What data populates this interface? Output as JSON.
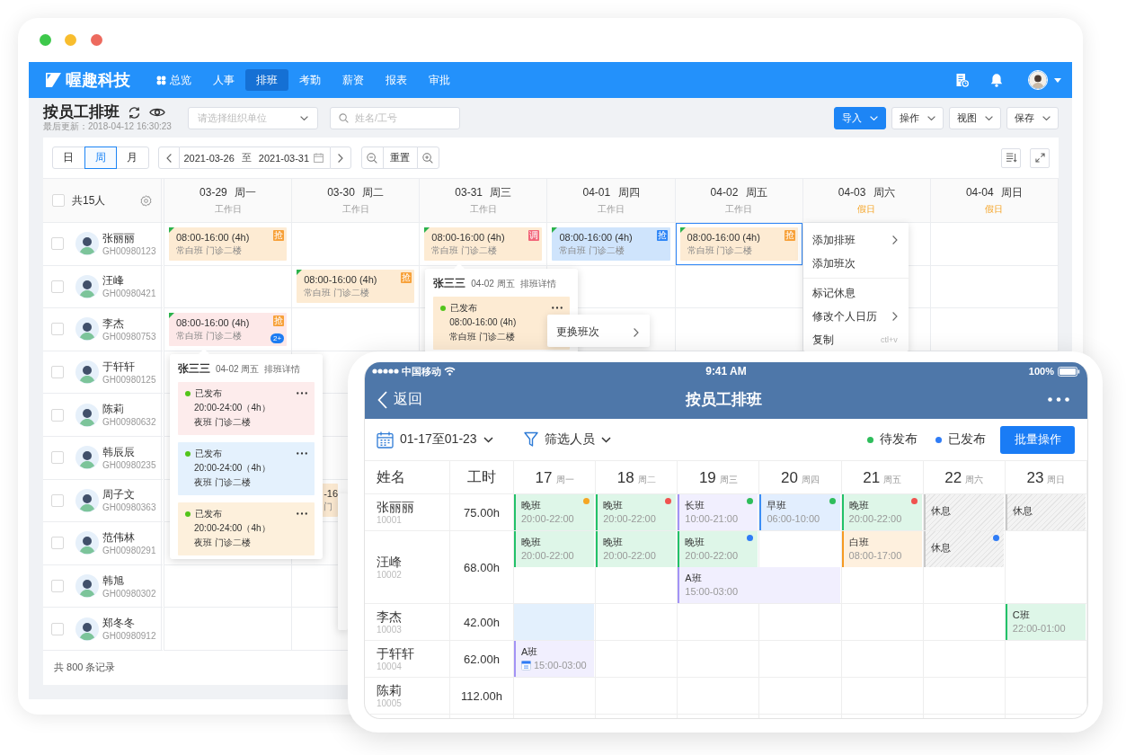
{
  "window": {
    "controls": [
      {
        "color": "#3dc84b"
      },
      {
        "color": "#f8bd2e"
      },
      {
        "color": "#ed6a5e"
      }
    ]
  },
  "desktop": {
    "app_bar": {
      "logo": "喔趣科技",
      "nav": [
        {
          "label": "总览",
          "icon": true,
          "selected": false
        },
        {
          "label": "人事",
          "selected": false
        },
        {
          "label": "排班",
          "selected": true
        },
        {
          "label": "考勤",
          "selected": false
        },
        {
          "label": "薪资",
          "selected": false
        },
        {
          "label": "报表",
          "selected": false
        },
        {
          "label": "审批",
          "selected": false
        }
      ]
    },
    "page_header": {
      "title": "按员工排班",
      "updated": "最后更新：2018-04-12 16:30:23",
      "org_select": {
        "placeholder": "请选择组织单位"
      },
      "search": {
        "placeholder": "姓名/工号"
      },
      "actions": [
        {
          "label": "导入",
          "kind": "primary"
        },
        {
          "label": "操作",
          "kind": "default"
        },
        {
          "label": "视图",
          "kind": "default"
        },
        {
          "label": "保存",
          "kind": "default"
        }
      ]
    },
    "toolbar": {
      "views": [
        {
          "label": "日",
          "selected": false
        },
        {
          "label": "周",
          "selected": true
        },
        {
          "label": "月",
          "selected": false
        }
      ],
      "range": {
        "start": "2021-03-26",
        "separator": "至",
        "end": "2021-03-31"
      },
      "reset": "重置"
    },
    "table": {
      "header": {
        "count": "共15人",
        "checked": false
      },
      "days": [
        {
          "date": "03-29",
          "weekday": "周一",
          "type": "工作日",
          "holiday": false
        },
        {
          "date": "03-30",
          "weekday": "周二",
          "type": "工作日",
          "holiday": false
        },
        {
          "date": "03-31",
          "weekday": "周三",
          "type": "工作日",
          "holiday": false
        },
        {
          "date": "04-01",
          "weekday": "周四",
          "type": "工作日",
          "holiday": false
        },
        {
          "date": "04-02",
          "weekday": "周五",
          "type": "工作日",
          "holiday": false
        },
        {
          "date": "04-03",
          "weekday": "周六",
          "type": "假日",
          "holiday": true
        },
        {
          "date": "04-04",
          "weekday": "周日",
          "type": "假日",
          "holiday": true
        }
      ],
      "rows": [
        {
          "name": "张丽丽",
          "id": "GH00980123",
          "checked": false,
          "cells": [
            {
              "selected": false,
              "shift": {
                "time": "08:00-16:00 (4h)",
                "place": "常白班 门诊二楼",
                "color": "#fdebd3",
                "flag": true,
                "badge": {
                  "text": "抢",
                  "color": "#f7a13a"
                }
              }
            },
            {
              "selected": false
            },
            {
              "selected": false,
              "shift": {
                "time": "08:00-16:00 (4h)",
                "place": "常白班 门诊二楼",
                "color": "#fdebd3",
                "flag": true,
                "badge": {
                  "text": "调",
                  "color": "#f26579"
                }
              },
              "popover": {
                "name": "张三三",
                "date": "04-02 周五",
                "title": "排班详情",
                "entries": [
                  {
                    "status": "已发布",
                    "dot": {
                      "color": "#52c41a"
                    },
                    "time": "08:00-16:00 (4h)",
                    "place": "常白班 门诊二楼",
                    "color": "#fdebd3",
                    "menu": {
                      "items": [
                        {
                          "label": "更换班次",
                          "kind": "submenu"
                        }
                      ]
                    }
                  }
                ]
              }
            },
            {
              "selected": false,
              "shift": {
                "time": "08:00-16:00 (4h)",
                "place": "常白班 门诊二楼",
                "color": "#cfe4fc",
                "flag": true,
                "badge": {
                  "text": "抢",
                  "color": "#2f86f6"
                }
              }
            },
            {
              "selected": true,
              "shift": {
                "time": "08:00-16:00 (4h)",
                "place": "常白班 门诊二楼",
                "color": "#fdebd3",
                "flag": true,
                "badge": {
                  "text": "抢",
                  "color": "#f7a13a"
                }
              },
              "menu": {
                "items": [
                  {
                    "label": "添加排班",
                    "kind": "submenu"
                  },
                  {
                    "label": "添加班次",
                    "kind": "plain"
                  },
                  {
                    "kind": "divider"
                  },
                  {
                    "label": "标记休息",
                    "kind": "plain"
                  },
                  {
                    "label": "修改个人日历",
                    "kind": "submenu"
                  },
                  {
                    "label": "复制",
                    "kind": "shortcut",
                    "shortcut": "ctl+v"
                  }
                ]
              }
            },
            {
              "selected": false
            },
            {
              "selected": false
            }
          ]
        },
        {
          "name": "汪峰",
          "id": "GH00980421",
          "checked": false,
          "cells": [
            {
              "selected": false
            },
            {
              "selected": false,
              "shift": {
                "time": "08:00-16:00 (4h)",
                "place": "常白班 门诊二楼",
                "color": "#fdebd3",
                "flag": true,
                "badge": {
                  "text": "抢",
                  "color": "#f7a13a"
                }
              }
            },
            {
              "selected": false
            },
            {
              "selected": false
            },
            {
              "selected": false
            },
            {
              "selected": false
            },
            {
              "selected": false
            }
          ]
        },
        {
          "name": "李杰",
          "id": "GH00980753",
          "checked": false,
          "cells": [
            {
              "selected": false,
              "shift": {
                "time": "08:00-16:00 (4h)",
                "place": "常白班 门诊二楼",
                "color": "#fde8e8",
                "flag": true,
                "badge": {
                  "text": "抢",
                  "color": "#f7a13a"
                },
                "more": "2+"
              },
              "popover": {
                "name": "张三三",
                "date": "04-02 周五",
                "title": "排班详情",
                "entries": [
                  {
                    "status": "已发布",
                    "dot": {
                      "color": "#52c41a"
                    },
                    "time": "20:00-24:00（4h）",
                    "place": "夜班 门诊二楼",
                    "color": "#fdecec"
                  },
                  {
                    "status": "已发布",
                    "dot": {
                      "color": "#52c41a"
                    },
                    "time": "20:00-24:00（4h）",
                    "place": "夜班 门诊二楼",
                    "color": "#e4f1fd"
                  },
                  {
                    "status": "已发布",
                    "dot": {
                      "color": "#52c41a"
                    },
                    "time": "20:00-24:00（4h）",
                    "place": "夜班 门诊二楼",
                    "color": "#fdf0dc"
                  }
                ]
              }
            },
            {
              "selected": false
            },
            {
              "selected": false
            },
            {
              "selected": false
            },
            {
              "selected": false
            },
            {
              "selected": false
            },
            {
              "selected": false
            }
          ]
        },
        {
          "name": "于轩轩",
          "id": "GH00980125",
          "checked": false,
          "cells": [
            {
              "selected": false
            }
          ]
        },
        {
          "name": "陈莉",
          "id": "GH00980632",
          "checked": false,
          "cells": [
            {
              "selected": false
            }
          ]
        },
        {
          "name": "韩辰辰",
          "id": "GH00980235",
          "checked": false,
          "cells": [
            {
              "selected": false
            }
          ]
        },
        {
          "name": "周子文",
          "id": "GH00980363",
          "checked": false,
          "cells": [
            {
              "selected": false
            },
            {
              "selected": false,
              "shift": {
                "time": "-16",
                "place": "门",
                "color": "#fdebd3",
                "clipped": true
              },
              "menu": {
                "clipped": true
              }
            }
          ]
        },
        {
          "name": "范伟林",
          "id": "GH00980291",
          "checked": false,
          "cells": [
            {
              "selected": false
            }
          ]
        },
        {
          "name": "韩旭",
          "id": "GH00980302",
          "checked": false,
          "cells": [
            {
              "selected": false
            }
          ]
        },
        {
          "name": "郑冬冬",
          "id": "GH00980912",
          "checked": false,
          "cells": [
            {
              "selected": false
            }
          ]
        }
      ]
    },
    "footer": "共 800 条记录"
  },
  "mobile": {
    "status_bar": {
      "carrier": "中国移动",
      "time": "9:41 AM",
      "battery": "100%"
    },
    "nav_bar": {
      "back": "返回",
      "title": "按员工排班"
    },
    "toolbar": {
      "range": "01-17至01-23",
      "filter": "筛选人员",
      "legend": [
        {
          "label": "待发布",
          "color": "#2ebd5b"
        },
        {
          "label": "已发布",
          "color": "#2f7cf6"
        }
      ],
      "batch": "批量操作"
    },
    "table": {
      "name_header": "姓名",
      "hours_header": "工时",
      "days": [
        {
          "day": "17",
          "weekday": "周一"
        },
        {
          "day": "18",
          "weekday": "周二"
        },
        {
          "day": "19",
          "weekday": "周三"
        },
        {
          "day": "20",
          "weekday": "周四"
        },
        {
          "day": "21",
          "weekday": "周五"
        },
        {
          "day": "22",
          "weekday": "周六"
        },
        {
          "day": "23",
          "weekday": "周日"
        }
      ],
      "rows": [
        {
          "name": "张丽丽",
          "id": "10001",
          "hours": "75.00h",
          "lanes": [
            [
              {
                "kind": "shift",
                "name": "晚班",
                "time": "20:00-22:00",
                "color": "#22c168",
                "dot": {
                  "color": "#f5a623"
                }
              },
              {
                "kind": "shift",
                "name": "晚班",
                "time": "20:00-22:00",
                "color": "#22c168",
                "dot": {
                  "color": "#f0524f"
                }
              },
              {
                "kind": "shift",
                "name": "长班",
                "time": "10:00-21:00",
                "color": "#a393f5",
                "dot": {
                  "color": "#2ebd5b"
                }
              },
              {
                "kind": "shift",
                "name": "早班",
                "time": "06:00-10:00",
                "color": "#3b8ef5",
                "dot": {
                  "color": "#2ebd5b"
                }
              },
              {
                "kind": "shift",
                "name": "晚班",
                "time": "20:00-22:00",
                "color": "#22c168",
                "dot": {
                  "color": "#f0524f"
                }
              },
              {
                "kind": "rest",
                "label": "休息"
              },
              {
                "kind": "rest",
                "label": "休息"
              }
            ]
          ]
        },
        {
          "name": "汪峰",
          "id": "10002",
          "hours": "68.00h",
          "lanes": [
            [
              {
                "kind": "shift",
                "name": "晚班",
                "time": "20:00-22:00",
                "color": "#22c168"
              },
              {
                "kind": "shift",
                "name": "晚班",
                "time": "20:00-22:00",
                "color": "#22c168"
              },
              {
                "kind": "shift",
                "name": "晚班",
                "time": "20:00-22:00",
                "color": "#22c168",
                "dot": {
                  "color": "#2f7cf6"
                }
              },
              {
                "kind": "empty"
              },
              {
                "kind": "shift",
                "name": "白班",
                "time": "08:00-17:00",
                "color": "#f59a23"
              },
              {
                "kind": "rest",
                "label": "休息",
                "dot": {
                  "color": "#2f7cf6"
                }
              },
              {
                "kind": "empty"
              }
            ],
            [
              {
                "kind": "empty"
              },
              {
                "kind": "empty"
              },
              {
                "kind": "shift",
                "name": "A班",
                "time": "15:00-03:00",
                "color": "#a393f5",
                "wide": true
              },
              {
                "kind": "empty"
              },
              {
                "kind": "empty"
              },
              {
                "kind": "empty"
              }
            ]
          ]
        },
        {
          "name": "李杰",
          "id": "10003",
          "hours": "42.00h",
          "lanes": [
            [
              {
                "kind": "highlight"
              },
              {
                "kind": "empty"
              },
              {
                "kind": "empty"
              },
              {
                "kind": "empty"
              },
              {
                "kind": "empty"
              },
              {
                "kind": "empty"
              },
              {
                "kind": "shift",
                "name": "C班",
                "time": "22:00-01:00",
                "color": "#22c168"
              }
            ]
          ]
        },
        {
          "name": "于轩轩",
          "id": "10004",
          "hours": "62.00h",
          "lanes": [
            [
              {
                "kind": "shift",
                "name": "A班",
                "time": "15:00-03:00",
                "color": "#a393f5",
                "calendar": true
              },
              {
                "kind": "empty"
              },
              {
                "kind": "empty"
              },
              {
                "kind": "empty"
              },
              {
                "kind": "empty"
              },
              {
                "kind": "empty"
              },
              {
                "kind": "empty"
              }
            ]
          ]
        },
        {
          "name": "陈莉",
          "id": "10005",
          "hours": "112.00h",
          "lanes": [
            [
              {
                "kind": "empty"
              },
              {
                "kind": "empty"
              },
              {
                "kind": "empty"
              },
              {
                "kind": "empty"
              },
              {
                "kind": "empty"
              },
              {
                "kind": "empty"
              },
              {
                "kind": "empty"
              }
            ]
          ]
        }
      ]
    }
  }
}
